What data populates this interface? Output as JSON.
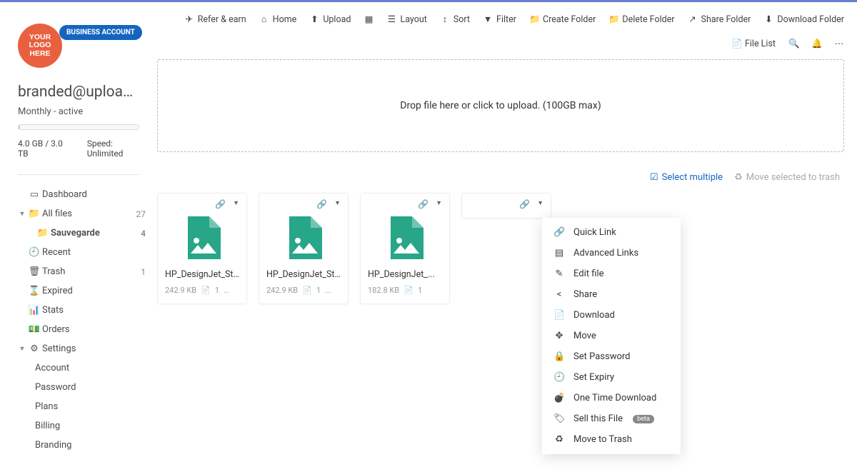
{
  "account": {
    "logo_text": "YOUR\nLOGO\nHERE",
    "badge": "BUSINESS ACCOUNT",
    "email": "branded@uploadfile...",
    "plan": "Monthly - active",
    "storage": "4.0 GB / 3.0 TB",
    "speed": "Speed: Unlimited"
  },
  "nav": {
    "dashboard": "Dashboard",
    "all_files": "All files",
    "all_files_count": "27",
    "sauvegarde": "Sauvegarde",
    "sauvegarde_count": "4",
    "recent": "Recent",
    "trash": "Trash",
    "trash_count": "1",
    "expired": "Expired",
    "stats": "Stats",
    "orders": "Orders",
    "settings": "Settings",
    "account": "Account",
    "password": "Password",
    "plans": "Plans",
    "billing": "Billing",
    "branding": "Branding"
  },
  "toolbar": {
    "refer": "Refer & earn",
    "home": "Home",
    "upload": "Upload",
    "layout": "Layout",
    "sort": "Sort",
    "filter": "Filter",
    "create_folder": "Create Folder",
    "delete_folder": "Delete Folder",
    "share_folder": "Share Folder",
    "download_folder": "Download Folder",
    "file_list": "File List"
  },
  "dropzone": "Drop file here or click to upload. (100GB max)",
  "actions": {
    "select_multiple": "Select multiple",
    "move_trash": "Move selected to trash"
  },
  "files": [
    {
      "name": "HP_DesignJet_St...",
      "size": "242.9 KB",
      "dl": "1"
    },
    {
      "name": "HP_DesignJet_St...",
      "size": "242.9 KB",
      "dl": "1"
    },
    {
      "name": "HP_DesignJet_...",
      "size": "182.8 KB",
      "dl": "1"
    },
    {
      "name": "",
      "size": "",
      "dl": ""
    }
  ],
  "menu": {
    "quick_link": "Quick Link",
    "advanced_links": "Advanced Links",
    "edit_file": "Edit file",
    "share": "Share",
    "download": "Download",
    "move": "Move",
    "set_password": "Set Password",
    "set_expiry": "Set Expiry",
    "one_time": "One Time Download",
    "sell": "Sell this File",
    "sell_beta": "beta",
    "move_trash": "Move to Trash"
  }
}
